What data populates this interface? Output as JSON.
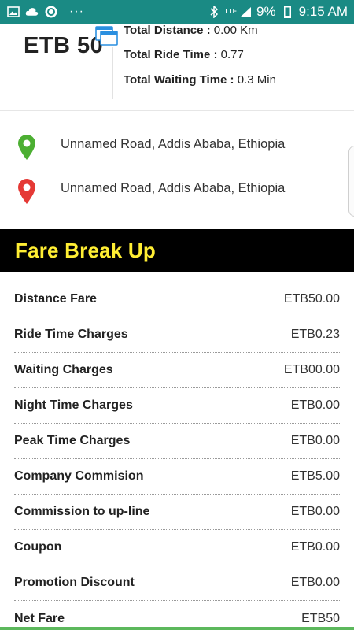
{
  "status_bar": {
    "battery": "9%",
    "time": "9:15 AM",
    "network": "LTE",
    "dots": "···",
    "icons": [
      "image-icon",
      "cloud-icon",
      "app-icon",
      "bluetooth-icon",
      "signal-icon",
      "battery-icon"
    ]
  },
  "summary": {
    "fare_amount": "ETB 50",
    "total_distance": {
      "label": "Total Distance :",
      "value": "0.00 Km"
    },
    "total_ride_time": {
      "label": "Total Ride Time :",
      "value": "0.77"
    },
    "total_waiting_time": {
      "label": "Total Waiting Time :",
      "value": "0.3 Min"
    }
  },
  "addresses": {
    "pickup": "Unnamed Road, Addis Ababa, Ethiopia",
    "dropoff": "Unnamed Road, Addis Ababa, Ethiopia"
  },
  "fare_breakup": {
    "title": "Fare Break Up",
    "rows": [
      {
        "label": "Distance Fare",
        "value": "ETB50.00"
      },
      {
        "label": "Ride Time Charges",
        "value": "ETB0.23"
      },
      {
        "label": "Waiting Charges",
        "value": "ETB00.00"
      },
      {
        "label": "Night Time Charges",
        "value": "ETB0.00"
      },
      {
        "label": "Peak Time Charges",
        "value": "ETB0.00"
      },
      {
        "label": "Company Commision",
        "value": "ETB5.00"
      },
      {
        "label": "Commission to up-line",
        "value": "ETB0.00"
      },
      {
        "label": "Coupon",
        "value": "ETB0.00"
      },
      {
        "label": "Promotion Discount",
        "value": "ETB0.00"
      },
      {
        "label": "Net Fare",
        "value": "ETB50"
      }
    ]
  },
  "colors": {
    "status_bar": "#1a8a84",
    "header_bg": "#000000",
    "header_text": "#ffee33",
    "pickup_pin": "#4caf32",
    "dropoff_pin": "#e53935",
    "bottom_accent": "#5cb85c"
  }
}
